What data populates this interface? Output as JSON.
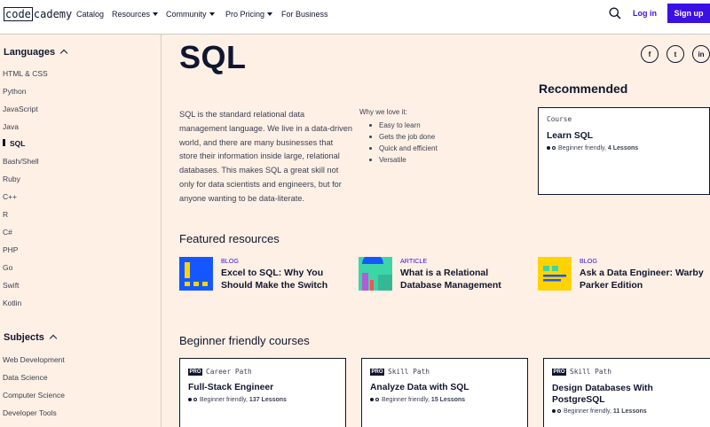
{
  "header": {
    "logo_box": "code",
    "logo_rest": "cademy",
    "nav": [
      {
        "label": "Catalog",
        "dropdown": false
      },
      {
        "label": "Resources",
        "dropdown": true
      },
      {
        "label": "Community",
        "dropdown": true
      },
      {
        "label": "Pro Pricing",
        "dropdown": true
      },
      {
        "label": "For Business",
        "dropdown": false
      }
    ],
    "search_icon": "search-icon",
    "login": "Log in",
    "signup": "Sign up"
  },
  "sidebar": {
    "languages_heading": "Languages",
    "languages": [
      "HTML & CSS",
      "Python",
      "JavaScript",
      "Java",
      "SQL",
      "Bash/Shell",
      "Ruby",
      "C++",
      "R",
      "C#",
      "PHP",
      "Go",
      "Swift",
      "Kotlin"
    ],
    "active_language": "SQL",
    "subjects_heading": "Subjects",
    "subjects": [
      "Web Development",
      "Data Science",
      "Computer Science",
      "Developer Tools"
    ]
  },
  "main": {
    "title": "SQL",
    "social": [
      "f",
      "t",
      "in"
    ],
    "description": "SQL is the standard relational data management language. We live in a data-driven world, and there are many businesses that store their information inside large, relational databases. This makes SQL a great skill not only for data scientists and engineers, but for anyone wanting to be data-literate.",
    "why_heading": "Why we love it:",
    "why_items": [
      "Easy to learn",
      "Gets the job done",
      "Quick and efficient",
      "Versatile"
    ]
  },
  "recommended": {
    "heading": "Recommended",
    "card": {
      "tag": "Course",
      "title": "Learn SQL",
      "level": "Beginner friendly,",
      "lessons": "4 Lessons"
    }
  },
  "featured": {
    "heading": "Featured resources",
    "items": [
      {
        "kind": "BLOG",
        "title_line1": "Excel to SQL: Why You",
        "title_line2": "Should Make the Switch"
      },
      {
        "kind": "ARTICLE",
        "title_line1": "What is a Relational",
        "title_line2": "Database Management"
      },
      {
        "kind": "BLOG",
        "title_line1": "Ask a Data Engineer: Warby",
        "title_line2": "Parker Edition"
      }
    ]
  },
  "courses": {
    "heading": "Beginner friendly courses",
    "pro_label": "PRO",
    "items": [
      {
        "tag": "Career Path",
        "title_line1": "Full-Stack Engineer",
        "title_line2": "",
        "level": "Beginner friendly,",
        "lessons": "137 Lessons"
      },
      {
        "tag": "Skill Path",
        "title_line1": "Analyze Data with SQL",
        "title_line2": "",
        "level": "Beginner friendly,",
        "lessons": "15 Lessons"
      },
      {
        "tag": "Skill Path",
        "title_line1": "Design Databases With",
        "title_line2": "PostgreSQL",
        "level": "Beginner friendly,",
        "lessons": "11 Lessons"
      }
    ]
  },
  "colors": {
    "accent": "#3a10e5",
    "ink": "#10162f",
    "background": "#fff0e5",
    "thumb_blue": "#1557ff",
    "thumb_yellow": "#ffd300",
    "thumb_green": "#3cd6a6"
  }
}
